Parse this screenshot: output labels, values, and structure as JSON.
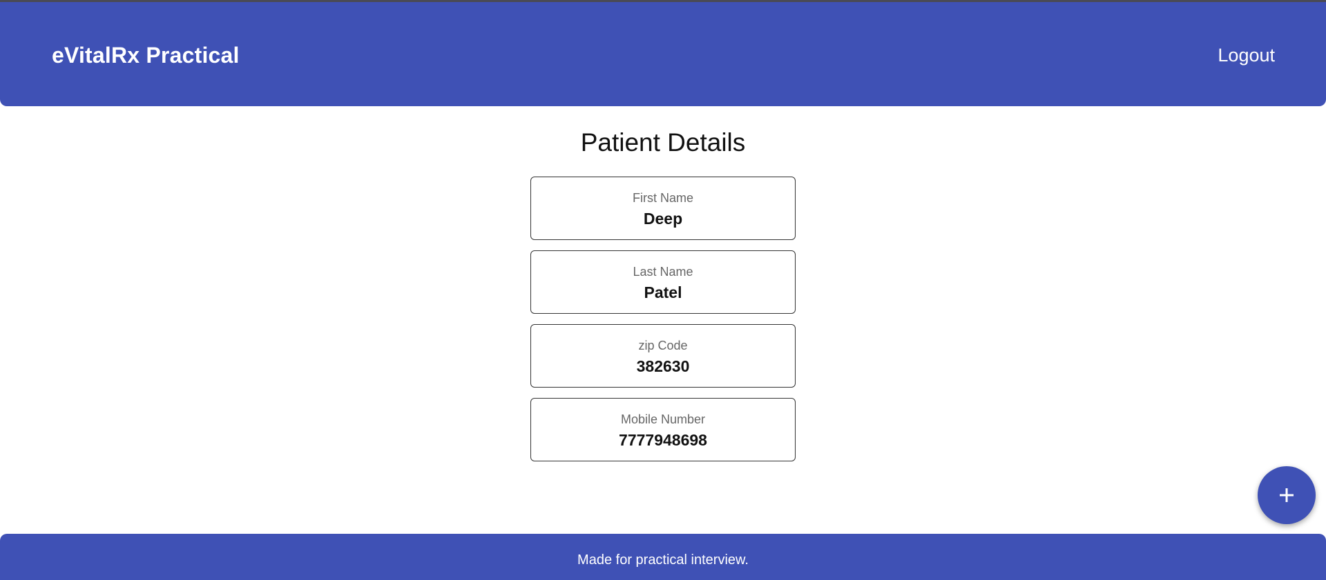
{
  "header": {
    "brand": "eVitalRx Practical",
    "logout_label": "Logout",
    "background_color": "#3f51b5"
  },
  "main": {
    "title": "Patient Details",
    "fields": [
      {
        "label": "First Name",
        "value": "Deep"
      },
      {
        "label": "Last Name",
        "value": "Patel"
      },
      {
        "label": "zip Code",
        "value": "382630"
      },
      {
        "label": "Mobile Number",
        "value": "7777948698"
      }
    ]
  },
  "fab": {
    "icon": "plus-icon"
  },
  "footer": {
    "text": "Made for practical interview."
  }
}
